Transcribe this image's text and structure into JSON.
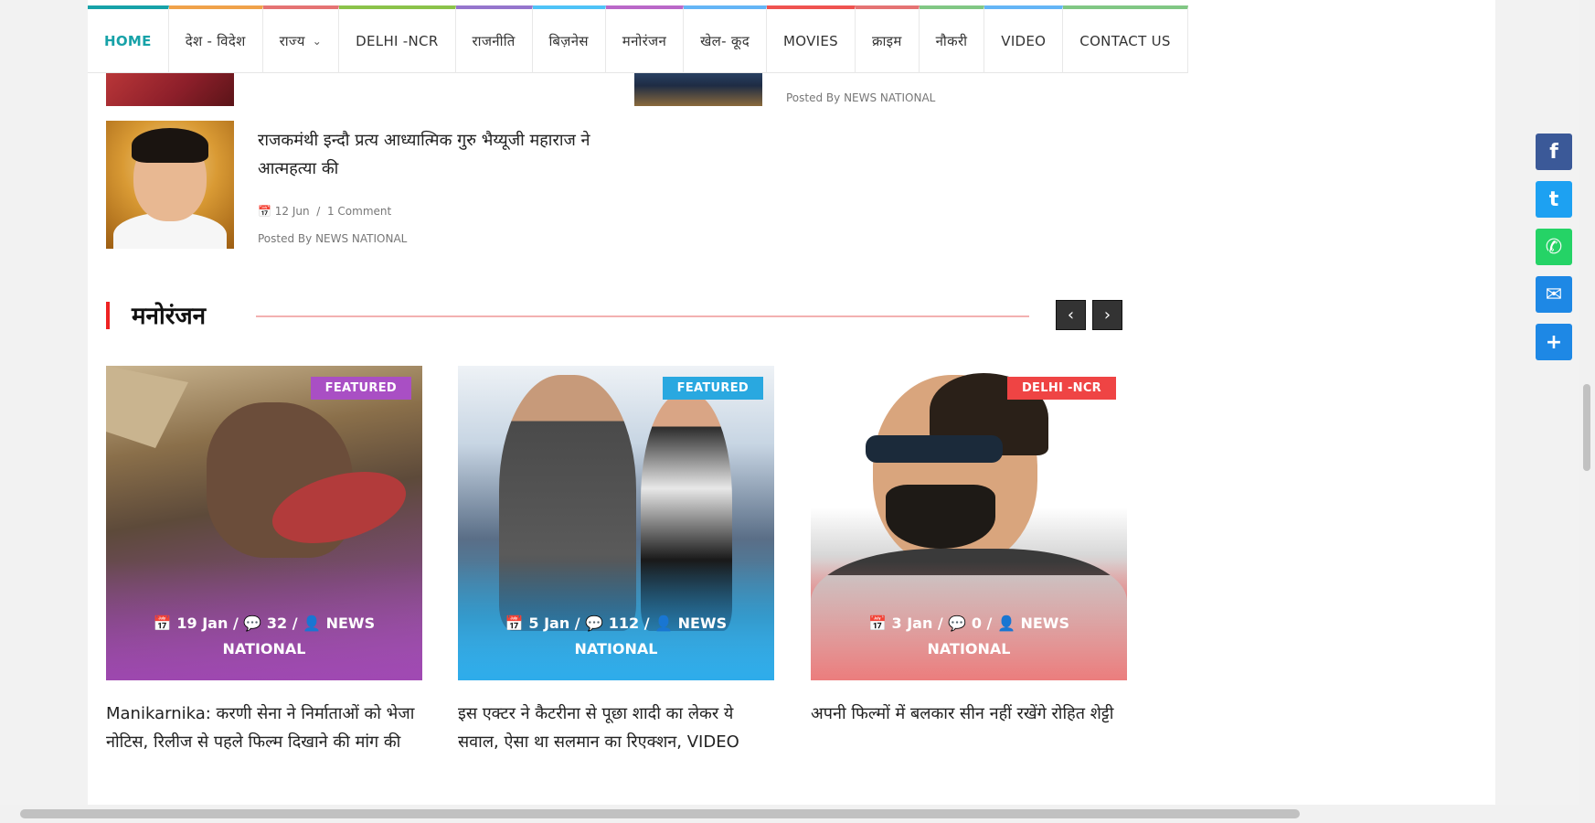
{
  "nav": {
    "items": [
      {
        "label": "HOME",
        "color": "#17a2a8"
      },
      {
        "label": "देश - विदेश",
        "color": "#f0a24a"
      },
      {
        "label": "राज्य",
        "color": "#e57373"
      },
      {
        "label": "DELHI -NCR",
        "color": "#8bc34a"
      },
      {
        "label": "राजनीति",
        "color": "#9575cd"
      },
      {
        "label": "बिज़नेस",
        "color": "#4fc3f7"
      },
      {
        "label": "मनोरंजन",
        "color": "#ba68c8"
      },
      {
        "label": "खेल- कूद",
        "color": "#64b5f6"
      },
      {
        "label": "MOVIES",
        "color": "#ef5350"
      },
      {
        "label": "क्राइम",
        "color": "#e57373"
      },
      {
        "label": "नौकरी",
        "color": "#81c784"
      },
      {
        "label": "VIDEO",
        "color": "#64b5f6"
      },
      {
        "label": "CONTACT US",
        "color": "#81c784"
      }
    ]
  },
  "top_posts": {
    "right_meta_posted": "Posted By NEWS NATIONAL",
    "main": {
      "title": "राजकमंथी इन्दौ प्रत्य आध्यात्मिक गुरु भैय्यूजी महाराज ने आत्महत्या की",
      "date": "12 Jun",
      "comments": "1 Comment",
      "posted": "Posted By NEWS NATIONAL"
    }
  },
  "section": {
    "title": "मनोरंजन",
    "prev_icon": "chevron-left-icon",
    "next_icon": "chevron-right-icon"
  },
  "cards": [
    {
      "badge": "FEATURED",
      "badge_color": "#a94fc4",
      "date": "19 Jan",
      "comments": "32",
      "author": "NEWS NATIONAL",
      "title": "Manikarnika: करणी सेना ने निर्माताओं को भेजा नोटिस, रिलीज से पहले फिल्म दिखाने की मांग की"
    },
    {
      "badge": "FEATURED",
      "badge_color": "#29a8e0",
      "date": "5 Jan",
      "comments": "112",
      "author": "NEWS NATIONAL",
      "title": "इस एक्टर ने कैटरीना से पूछा शादी का लेकर ये सवाल, ऐसा था सलमान का रिएक्शन, VIDEO"
    },
    {
      "badge": "DELHI -NCR",
      "badge_color": "#ef4444",
      "date": "3 Jan",
      "comments": "0",
      "author": "NEWS NATIONAL",
      "title": "अपनी फिल्मों में बलकार सीन नहीं रखेंगे रोहित शेट्टी"
    }
  ],
  "share": [
    {
      "name": "facebook-icon",
      "glyph": "f",
      "color": "#3b5998"
    },
    {
      "name": "twitter-icon",
      "glyph": "t",
      "color": "#1da1f2"
    },
    {
      "name": "whatsapp-icon",
      "glyph": "✆",
      "color": "#25d366"
    },
    {
      "name": "email-icon",
      "glyph": "✉",
      "color": "#1e88e5"
    },
    {
      "name": "share-plus-icon",
      "glyph": "+",
      "color": "#1e88e5"
    }
  ]
}
